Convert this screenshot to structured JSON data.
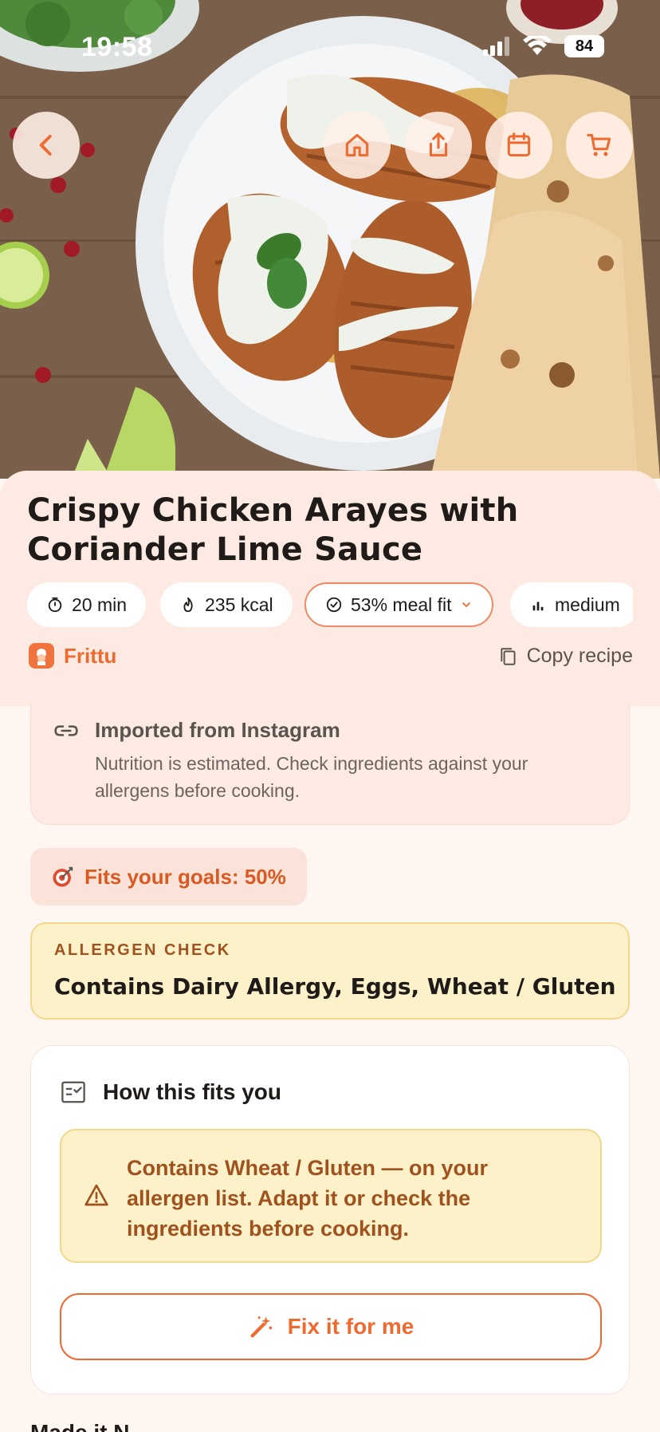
{
  "status_bar": {
    "time": "19:58",
    "battery": "84"
  },
  "hero": {
    "image_desc_icon": "food-photo"
  },
  "nav": {
    "back_icon": "chevron-left-icon",
    "home_icon": "home-icon",
    "share_icon": "share-icon",
    "calendar_icon": "calendar-icon",
    "cart_icon": "cart-icon"
  },
  "recipe": {
    "title": "Crispy Chicken Arayes with Coriander Lime Sauce",
    "chips": {
      "time": "20 min",
      "calories": "235 kcal",
      "meal_fit": "53% meal fit",
      "difficulty": "medium"
    },
    "brand": "Frittu",
    "copy_label": "Copy recipe"
  },
  "import_notice": {
    "title": "Imported from Instagram",
    "text": "Nutrition is estimated. Check ingredients against your allergens before cooking."
  },
  "goals": {
    "label": "Fits your goals: 50%"
  },
  "allergen_check": {
    "label": "ALLERGEN CHECK",
    "text": "Contains Dairy Allergy, Eggs, Wheat / Gluten"
  },
  "fits_you": {
    "title": "How this fits you",
    "warning": "Contains Wheat / Gluten — on your allergen list. Adapt it or check the ingredients before cooking.",
    "fix_button": "Fix it for me"
  },
  "next_section": {
    "title": "Made it N"
  },
  "colors": {
    "accent": "#EE6A2F",
    "panel": "#FDEAE3",
    "warning_bg": "#FDF1C9",
    "warning_text": "#A0521E"
  }
}
